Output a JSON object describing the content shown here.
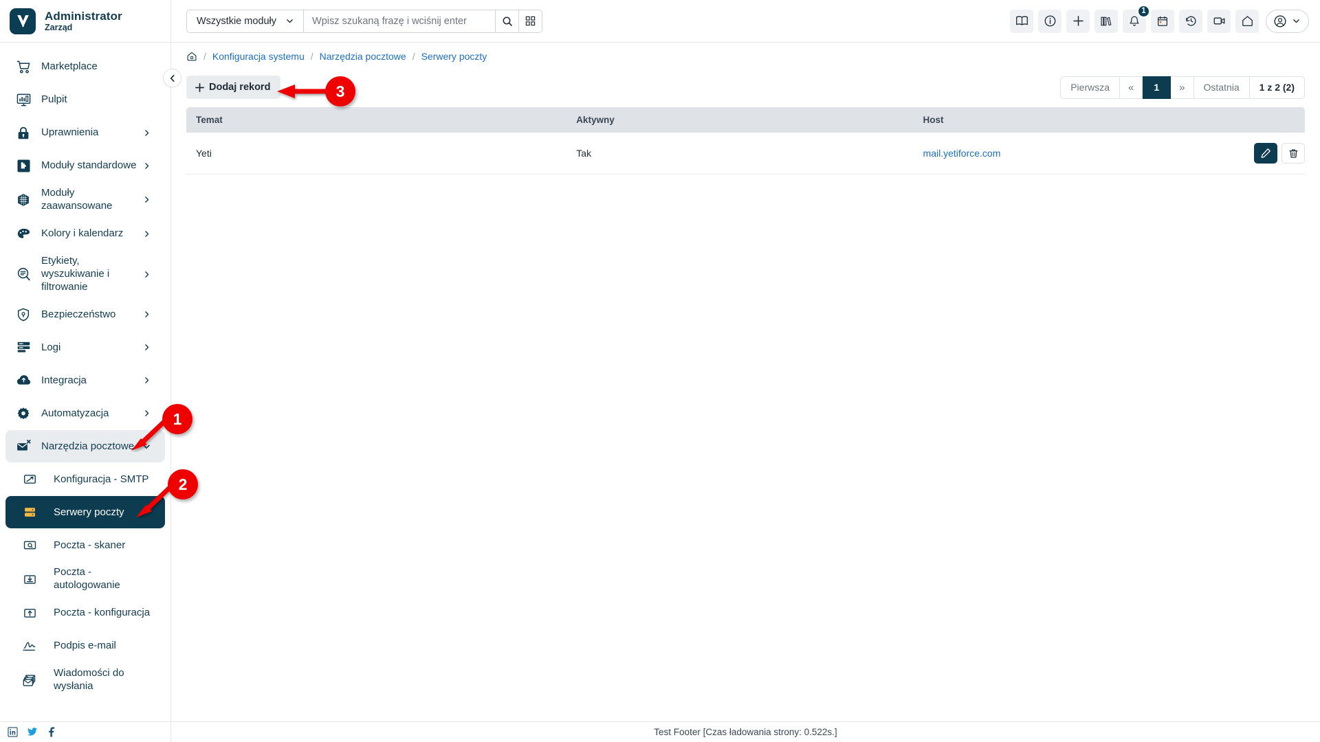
{
  "brand": {
    "title": "Administrator",
    "subtitle": "Zarząd",
    "logo_icon": "yetiforce-logo-icon"
  },
  "search": {
    "module_label": "Wszystkie moduły",
    "placeholder": "Wpisz szukaną frazę i wciśnij enter",
    "value": "",
    "search_icon": "search-icon",
    "grid_icon": "grid-icon",
    "chevron_icon": "chevron-down-icon"
  },
  "topbar_icons": [
    {
      "name": "book-icon",
      "glyph": "book"
    },
    {
      "name": "info-icon",
      "glyph": "info"
    },
    {
      "name": "plus-icon",
      "glyph": "plus"
    },
    {
      "name": "library-icon",
      "glyph": "library"
    },
    {
      "name": "bell-icon",
      "glyph": "bell",
      "badge": "1"
    },
    {
      "name": "calendar-icon",
      "glyph": "calendar"
    },
    {
      "name": "history-icon",
      "glyph": "history"
    },
    {
      "name": "video-icon",
      "glyph": "video"
    },
    {
      "name": "home-icon",
      "glyph": "home"
    }
  ],
  "user_menu": {
    "avatar_icon": "user-circle-icon",
    "chevron_icon": "chevron-down-icon"
  },
  "sidebar": {
    "collapse_icon": "chevron-left-icon",
    "items": [
      {
        "label": "Marketplace",
        "icon": "cart-icon",
        "expandable": false
      },
      {
        "label": "Pulpit",
        "icon": "dashboard-icon",
        "expandable": false
      },
      {
        "label": "Uprawnienia",
        "icon": "lock-icon",
        "expandable": true
      },
      {
        "label": "Moduły standardowe",
        "icon": "puzzle-icon",
        "expandable": true
      },
      {
        "label": "Moduły zaawansowane",
        "icon": "cube-icon",
        "expandable": true
      },
      {
        "label": "Kolory i kalendarz",
        "icon": "palette-icon",
        "expandable": true
      },
      {
        "label": "Etykiety, wyszukiwanie i filtrowanie",
        "icon": "search-label-icon",
        "expandable": true
      },
      {
        "label": "Bezpieczeństwo",
        "icon": "shield-icon",
        "expandable": true
      },
      {
        "label": "Logi",
        "icon": "logs-icon",
        "expandable": true
      },
      {
        "label": "Integracja",
        "icon": "cloud-icon",
        "expandable": true
      },
      {
        "label": "Automatyzacja",
        "icon": "gear-icon",
        "expandable": true
      },
      {
        "label": "Narzędzia pocztowe",
        "icon": "mail-tools-icon",
        "expandable": true,
        "state": "open"
      }
    ],
    "subitems": [
      {
        "label": "Konfiguracja - SMTP",
        "icon": "smtp-icon",
        "active": false
      },
      {
        "label": "Serwery poczty",
        "icon": "server-icon",
        "active": true
      },
      {
        "label": "Poczta - skaner",
        "icon": "mail-scanner-icon",
        "active": false
      },
      {
        "label": "Poczta - autologowanie",
        "icon": "mail-autologin-icon",
        "active": false
      },
      {
        "label": "Poczta - konfiguracja",
        "icon": "mail-config-icon",
        "active": false
      },
      {
        "label": "Podpis e-mail",
        "icon": "signature-icon",
        "active": false
      },
      {
        "label": "Wiadomości do wysłania",
        "icon": "outbox-icon",
        "active": false
      }
    ],
    "social": [
      {
        "name": "linkedin-icon"
      },
      {
        "name": "twitter-icon"
      },
      {
        "name": "facebook-icon"
      }
    ]
  },
  "breadcrumb": {
    "home_icon": "home-icon",
    "separator": "/",
    "items": [
      {
        "label": "Konfiguracja systemu"
      },
      {
        "label": "Narzędzia pocztowe"
      },
      {
        "label": "Serwery poczty"
      }
    ]
  },
  "toolbar": {
    "add_label": "Dodaj rekord",
    "add_icon": "plus-icon"
  },
  "pagination": {
    "first": "Pierwsza",
    "prev": "«",
    "current": "1",
    "next": "»",
    "last": "Ostatnia",
    "info": "1 z 2 (2)"
  },
  "table": {
    "columns": [
      "Temat",
      "Aktywny",
      "Host",
      ""
    ],
    "rows": [
      {
        "temat": "Yeti",
        "aktywny": "Tak",
        "host": "mail.yetiforce.com",
        "edit_icon": "pencil-icon",
        "delete_icon": "trash-icon"
      }
    ]
  },
  "footer": {
    "text": "Test Footer [Czas ładowania strony: 0.522s.]"
  },
  "annotations": [
    {
      "number": "1"
    },
    {
      "number": "2"
    },
    {
      "number": "3"
    }
  ],
  "colors": {
    "brand_dark": "#0d3b4f",
    "link": "#1b6ec2",
    "annotation_red": "#ee0000",
    "accent_yellow": "#f5b942"
  }
}
